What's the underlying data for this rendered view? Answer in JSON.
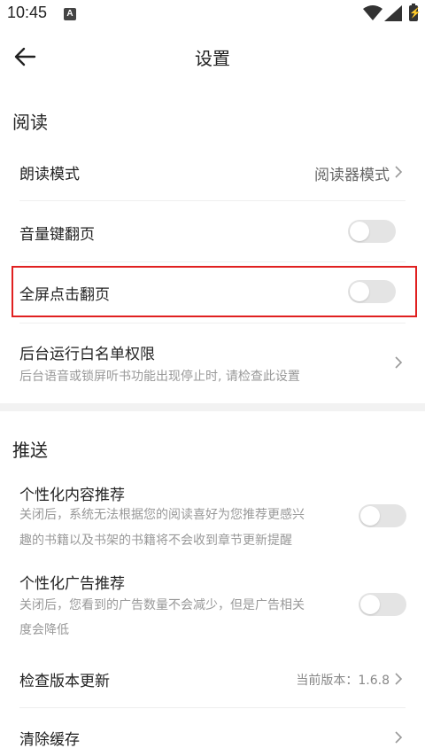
{
  "status": {
    "time": "10:45",
    "notification_badge": "A",
    "battery_glyph": "⚡"
  },
  "header": {
    "title": "设置"
  },
  "sections": {
    "reading": {
      "title": "阅读",
      "read_aloud_mode": {
        "label": "朗读模式",
        "value": "阅读器模式"
      },
      "volume_key_turn": {
        "label": "音量键翻页",
        "enabled": false
      },
      "fullscreen_tap_turn": {
        "label": "全屏点击翻页",
        "enabled": false
      },
      "background_whitelist": {
        "label": "后台运行白名单权限",
        "description": "后台语音或锁屏听书功能出现停止时, 请检查此设置"
      }
    },
    "push": {
      "title": "推送",
      "personalized_content": {
        "label": "个性化内容推荐",
        "description_line1": "关闭后，系统无法根据您的阅读喜好为您推荐更感兴",
        "description_line2": "趣的书籍以及书架的书籍将不会收到章节更新提醒",
        "enabled": false
      },
      "personalized_ads": {
        "label": "个性化广告推荐",
        "description_line1": "关闭后，您看到的广告数量不会减少，但是广告相关",
        "description_line2": "度会降低",
        "enabled": false
      },
      "check_update": {
        "label": "检查版本更新",
        "value": "当前版本：1.6.8"
      },
      "clear_cache": {
        "label": "清除缓存"
      }
    }
  },
  "colors": {
    "highlight": "#e02020",
    "toggle_off": "#e4e4e4"
  }
}
